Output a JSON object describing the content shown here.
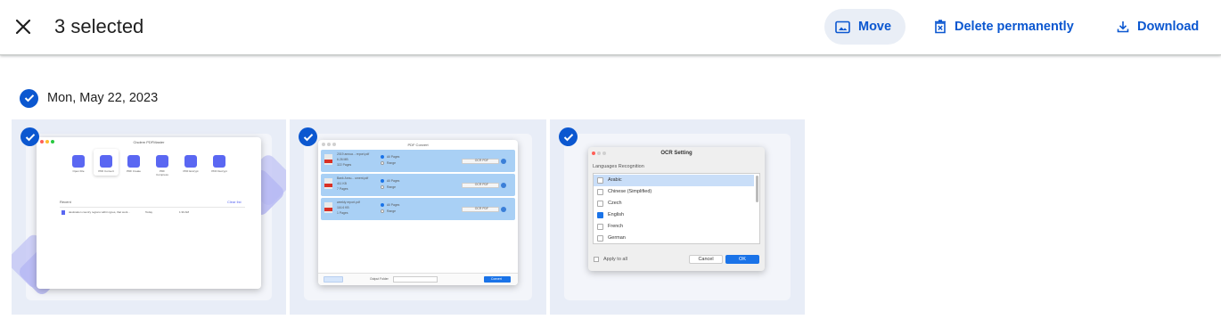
{
  "toolbar": {
    "selected_text": "3 selected",
    "move_label": "Move",
    "delete_label": "Delete permanently",
    "download_label": "Download"
  },
  "group": {
    "date": "Mon, May 22, 2023"
  },
  "thumbnails": [
    {
      "name": "screenshot-dashboard",
      "window_title": "Cisdem PDFMaster",
      "tools": [
        "Open File",
        "PDF Convert",
        "PDF Create",
        "PDF Compress",
        "PDF Encrypt",
        "PDF Decrypt"
      ],
      "recent_label": "Recent",
      "clear_label": "Clear list",
      "recent_file": "destination country regions within types, that work...",
      "recent_date": "Today",
      "recent_time": "1:30 AM"
    },
    {
      "name": "screenshot-pdf-convert",
      "window_title": "PDF Convert",
      "files": [
        {
          "file": "2019 annua... report.pdf",
          "size": "6.26 MB",
          "pages": "322 Pages"
        },
        {
          "file": "Bank Annu... ument.pdf",
          "size": "411 KB",
          "pages": "7 Pages"
        },
        {
          "file": "weekly report.pdf",
          "size": "116.6 KB",
          "pages": "1 Pages"
        }
      ],
      "all_pages": "All Pages",
      "range": "Range",
      "ocr_button": "OCR PDF",
      "output_label": "Output Folder",
      "convert_button": "Convert"
    },
    {
      "name": "screenshot-ocr-setting",
      "window_title": "OCR Setting",
      "section_label": "Languages Recognition",
      "languages": [
        {
          "label": "Arabic",
          "checked": false,
          "highlight": true
        },
        {
          "label": "Chinese (Simplified)",
          "checked": false,
          "highlight": false
        },
        {
          "label": "Czech",
          "checked": false,
          "highlight": false
        },
        {
          "label": "English",
          "checked": true,
          "highlight": false
        },
        {
          "label": "French",
          "checked": false,
          "highlight": false
        },
        {
          "label": "German",
          "checked": false,
          "highlight": false
        }
      ],
      "apply_all": "Apply to all",
      "cancel": "Cancel",
      "ok": "OK"
    }
  ],
  "colors": {
    "accent": "#0b57d0",
    "tile_bg": "#e8edf7",
    "move_bg": "#e9eef6"
  }
}
